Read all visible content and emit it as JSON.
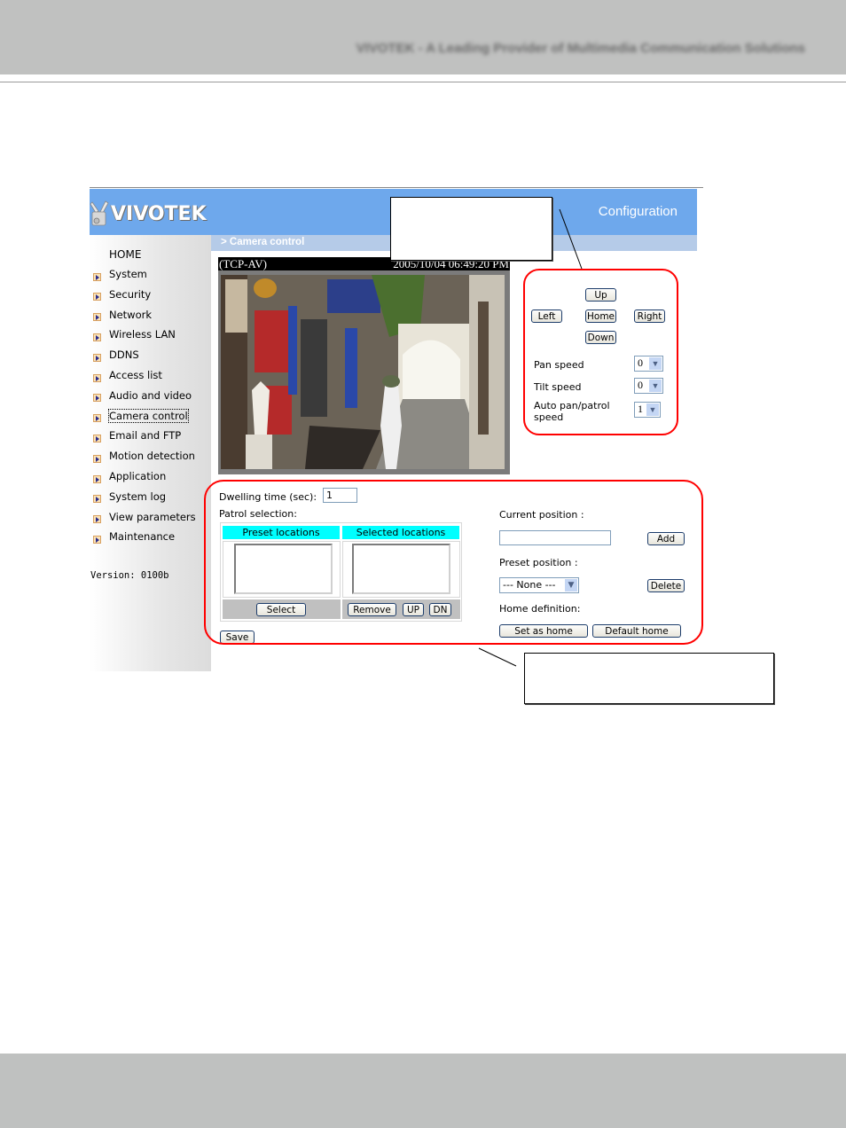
{
  "page": {
    "header_tagline": "VIVOTEK - A Leading Provider of Multimedia Communication Solutions"
  },
  "app": {
    "brand": "VIVOTEK",
    "section_title": "Configuration",
    "breadcrumb": "> Camera control",
    "version": "Version: 0100b"
  },
  "nav": {
    "home": "HOME",
    "items": [
      {
        "label": "System"
      },
      {
        "label": "Security"
      },
      {
        "label": "Network"
      },
      {
        "label": "Wireless LAN"
      },
      {
        "label": "DDNS"
      },
      {
        "label": "Access list"
      },
      {
        "label": "Audio and video"
      },
      {
        "label": "Camera control",
        "active": true
      },
      {
        "label": "Email and FTP"
      },
      {
        "label": "Motion detection"
      },
      {
        "label": "Application"
      },
      {
        "label": "System log"
      },
      {
        "label": "View parameters"
      },
      {
        "label": "Maintenance"
      }
    ]
  },
  "video": {
    "protocol": "(TCP-AV)",
    "timestamp": "2005/10/04 06:49:20 PM",
    "scene": "camera-live-view"
  },
  "ptz": {
    "up": "Up",
    "left": "Left",
    "home": "Home",
    "right": "Right",
    "down": "Down",
    "pan_speed_label": "Pan speed",
    "pan_speed_value": "0",
    "tilt_speed_label": "Tilt speed",
    "tilt_speed_value": "0",
    "auto_speed_label_line1": "Auto pan/patrol",
    "auto_speed_label_line2": "speed",
    "auto_speed_value": "1"
  },
  "patrol": {
    "dwelling_label": "Dwelling time (sec):",
    "dwelling_value": "1",
    "selection_label": "Patrol selection:",
    "preset_header": "Preset locations",
    "selected_header": "Selected locations",
    "select_btn": "Select",
    "remove_btn": "Remove",
    "up_btn": "UP",
    "dn_btn": "DN",
    "save_btn": "Save"
  },
  "position": {
    "current_label": "Current position :",
    "current_value": "",
    "add_btn": "Add",
    "preset_label": "Preset position :",
    "preset_value": "--- None ---",
    "delete_btn": "Delete",
    "home_label": "Home definition:",
    "set_home_btn": "Set as home",
    "default_home_btn": "Default home"
  },
  "callouts": {
    "top": "",
    "bottom": ""
  },
  "colors": {
    "banner": "#6ea8ec",
    "breadcrumb_bar": "#b5cbe8",
    "table_header": "#00ffff",
    "annotation": "#ff0000",
    "page_band": "#c0c1c0"
  }
}
